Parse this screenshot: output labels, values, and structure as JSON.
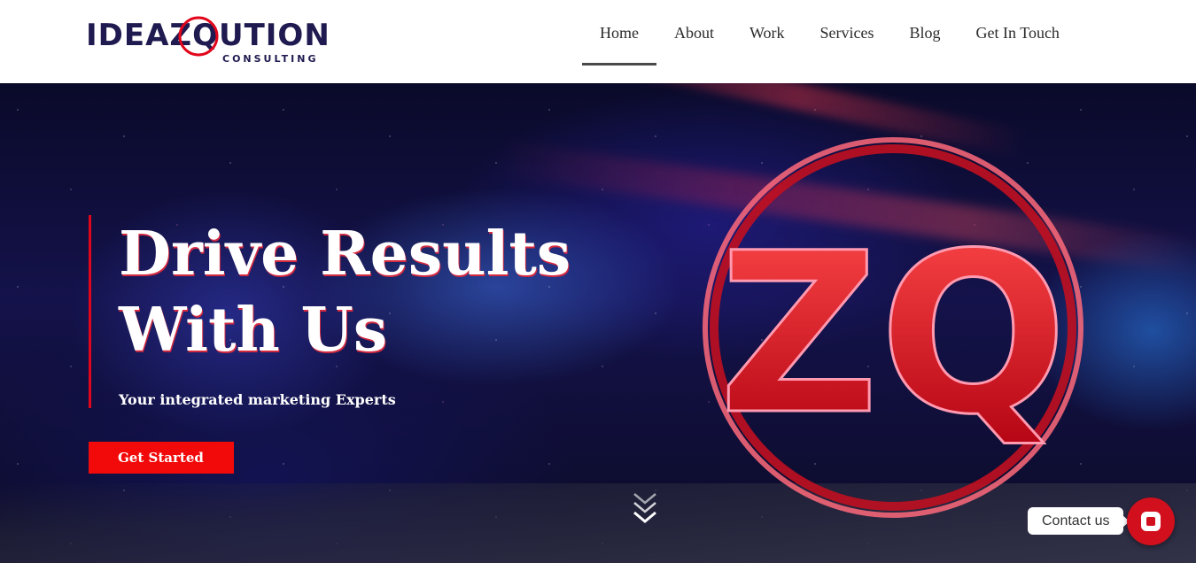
{
  "brand": {
    "name": "IDEAZQUTION",
    "tagline": "CONSULTING"
  },
  "nav": {
    "items": [
      {
        "label": "Home",
        "active": true
      },
      {
        "label": "About"
      },
      {
        "label": "Work"
      },
      {
        "label": "Services"
      },
      {
        "label": "Blog"
      },
      {
        "label": "Get In Touch"
      }
    ]
  },
  "hero": {
    "title_line1": "Drive Results",
    "title_line2": "With Us",
    "subtitle": "Your integrated marketing Experts",
    "cta_label": "Get Started",
    "emblem_text": "ZQ"
  },
  "contact": {
    "label": "Contact us"
  },
  "colors": {
    "brand_navy": "#1f1a4f",
    "accent_red": "#e1061b",
    "cta_red": "#f20a0a"
  }
}
